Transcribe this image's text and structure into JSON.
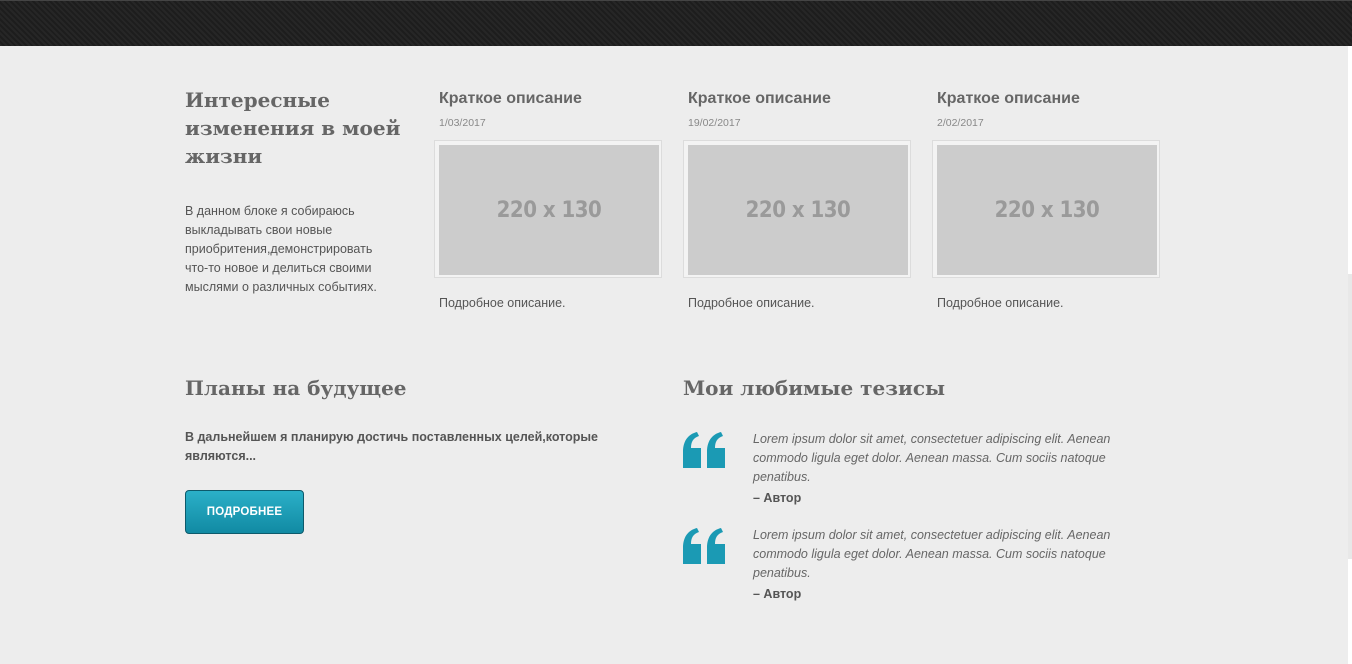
{
  "intro": {
    "title": "Интересные изменения в моей жизни",
    "text": "В данном блоке я собираюсь выкладывать свои новые приобритения,демонстрировать что-то новое и делиться своими мыслями о различных событиях."
  },
  "cards": [
    {
      "title": "Краткое описание",
      "date": "1/03/2017",
      "thumb_label": "220 x 130",
      "description": "Подробное описание."
    },
    {
      "title": "Краткое описание",
      "date": "19/02/2017",
      "thumb_label": "220 x 130",
      "description": "Подробное описание."
    },
    {
      "title": "Краткое описание",
      "date": "2/02/2017",
      "thumb_label": "220 x 130",
      "description": "Подробное описание."
    }
  ],
  "plans": {
    "title": "Планы на будущее",
    "text": "В дальнейшем я планирую достичь поставленных целей,которые являются...",
    "button_label": "ПОДРОБНЕЕ"
  },
  "theses": {
    "title": "Мои любимые тезисы",
    "quotes": [
      {
        "text": "Lorem ipsum dolor sit amet, consectetuer adipiscing elit. Aenean commodo ligula eget dolor. Aenean massa. Cum sociis natoque penatibus.",
        "author": "– Автор"
      },
      {
        "text": "Lorem ipsum dolor sit amet, consectetuer adipiscing elit. Aenean commodo ligula eget dolor. Aenean massa. Cum sociis natoque penatibus.",
        "author": "– Автор"
      }
    ]
  },
  "icons": {
    "quote": "quote-mark-icon"
  },
  "colors": {
    "accent": "#1b9ab4",
    "topbar": "#222222",
    "background": "#ededed"
  }
}
